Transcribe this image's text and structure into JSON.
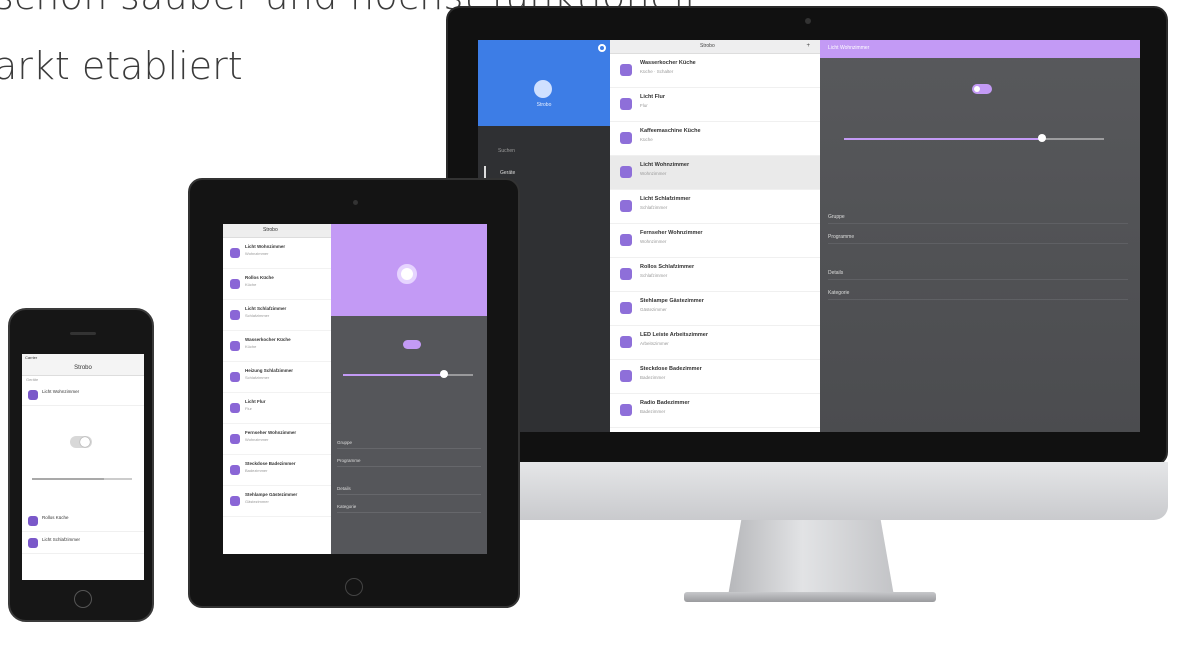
{
  "hero": {
    "line1": "schön sauber und höchst funktionell",
    "line2": "arkt etabliert"
  },
  "colors": {
    "accent_purple": "#c39af5",
    "accent_blue": "#3d7de6",
    "panel_dark": "#55565a"
  },
  "desktop": {
    "sidebar": {
      "app_label": "Strobo",
      "search_placeholder": "Suchen",
      "nav_item": "Geräte"
    },
    "list": {
      "header_title": "Strobo",
      "add_icon": "+",
      "items": [
        {
          "title": "Wasserkocher Küche",
          "subtitle": "Küche · Schalter",
          "icon": "kettle-icon"
        },
        {
          "title": "Licht Flur",
          "subtitle": "Flur",
          "icon": "lamp-icon"
        },
        {
          "title": "Kaffeemaschine Küche",
          "subtitle": "Küche",
          "icon": "coffee-icon"
        },
        {
          "title": "Licht Wohnzimmer",
          "subtitle": "Wohnzimmer",
          "icon": "lamp-icon"
        },
        {
          "title": "Licht Schlafzimmer",
          "subtitle": "Schlafzimmer",
          "icon": "bulb-icon"
        },
        {
          "title": "Fernseher Wohnzimmer",
          "subtitle": "Wohnzimmer",
          "icon": "tv-icon"
        },
        {
          "title": "Rollos Schlafzimmer",
          "subtitle": "Schlafzimmer",
          "icon": "blinds-icon"
        },
        {
          "title": "Stehlampe Gästezimmer",
          "subtitle": "Gästezimmer",
          "icon": "floor-lamp-icon"
        },
        {
          "title": "LED Leiste Arbeitszimmer",
          "subtitle": "Arbeitszimmer",
          "icon": "led-icon"
        },
        {
          "title": "Steckdose Badezimmer",
          "subtitle": "Badezimmer",
          "icon": "plug-icon"
        },
        {
          "title": "Radio Badezimmer",
          "subtitle": "Badezimmer",
          "icon": "radio-icon"
        }
      ]
    },
    "detail": {
      "bar_title": "Licht Wohnzimmer",
      "brightness_fraction": 0.76,
      "rows": [
        "Gruppe",
        "Programme",
        "Details",
        "Kategorie"
      ]
    }
  },
  "tablet": {
    "list": {
      "header_title": "Strobo",
      "items": [
        {
          "title": "Licht Wohnzimmer",
          "subtitle": "Wohnzimmer"
        },
        {
          "title": "Rollos Küche",
          "subtitle": "Küche"
        },
        {
          "title": "Licht Schlafzimmer",
          "subtitle": "Schlafzimmer"
        },
        {
          "title": "Wasserkocher Küche",
          "subtitle": "Küche"
        },
        {
          "title": "Heizung Schlafzimmer",
          "subtitle": "Schlafzimmer"
        },
        {
          "title": "Licht Flur",
          "subtitle": "Flur"
        },
        {
          "title": "Fernseher Wohnzimmer",
          "subtitle": "Wohnzimmer"
        },
        {
          "title": "Steckdose Badezimmer",
          "subtitle": "Badezimmer"
        },
        {
          "title": "Stehlampe Gästezimmer",
          "subtitle": "Gästezimmer"
        }
      ]
    },
    "detail": {
      "brightness_fraction": 0.78,
      "rows": [
        "Gruppe",
        "Programme",
        "Details",
        "Kategorie"
      ]
    }
  },
  "phone": {
    "status": "Carrier",
    "nav_title": "Strobo",
    "subheader": "Geräte",
    "items_top": [
      {
        "title": "Licht Wohnzimmer"
      }
    ],
    "items_bottom": [
      {
        "title": "Rollos Küche"
      },
      {
        "title": "Licht Schlafzimmer"
      }
    ],
    "brightness_fraction": 0.72
  }
}
